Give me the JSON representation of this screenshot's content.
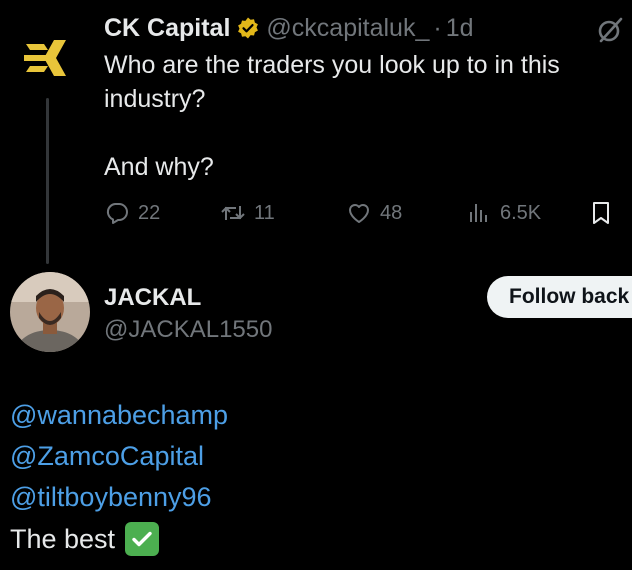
{
  "tweet": {
    "author_name": "CK Capital",
    "author_handle": "@ckcapitaluk_",
    "dot": "·",
    "time": "1d",
    "text": "Who are the traders you look up to in this\nindustry?\n\nAnd why?",
    "actions": {
      "replies": "22",
      "retweets": "11",
      "likes": "48",
      "views": "6.5K"
    }
  },
  "reply": {
    "author_name": "JACKAL",
    "author_handle": "@JACKAL1550",
    "follow_button": "Follow back",
    "mentions": [
      "@wannabechamp",
      "@ZamcoCapital",
      "@tiltboybenny96"
    ],
    "last_line": "The best"
  },
  "colors": {
    "background": "#000000",
    "text": "#e7e9ea",
    "muted": "#71767b",
    "link": "#4d9fe6",
    "verified_gold": "#e2b719",
    "logo_gold": "#e8c53a"
  },
  "icons": [
    "ck-logo-icon",
    "verified-badge-icon",
    "grok-icon",
    "reply-icon",
    "retweet-icon",
    "like-icon",
    "views-icon",
    "bookmark-icon",
    "check-mark-emoji"
  ]
}
